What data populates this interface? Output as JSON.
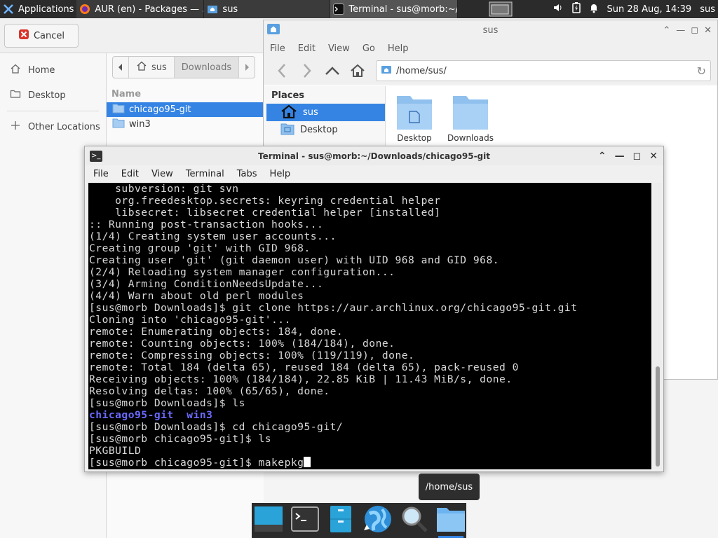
{
  "panel": {
    "applications_label": "Applications",
    "tasks": [
      {
        "label": "AUR (en) - Packages — ...",
        "icon": "firefox-icon"
      },
      {
        "label": "sus",
        "icon": "folder-home-icon"
      },
      {
        "label": "Terminal - sus@morb:~/...",
        "icon": "terminal-icon"
      }
    ],
    "clock": "Sun 28 Aug, 14:39",
    "user": "sus"
  },
  "chooser": {
    "cancel_label": "Cancel",
    "sidebar": [
      "Home",
      "Desktop",
      "Other Locations"
    ],
    "path": [
      "sus",
      "Downloads"
    ],
    "column_name": "Name",
    "files": [
      {
        "name": "chicago95-git",
        "selected": true
      },
      {
        "name": "win3",
        "selected": false
      }
    ]
  },
  "thunar": {
    "title": "sus",
    "menu": [
      "File",
      "Edit",
      "View",
      "Go",
      "Help"
    ],
    "location": "/home/sus/",
    "places_header": "Places",
    "places": [
      {
        "label": "sus",
        "selected": true
      },
      {
        "label": "Desktop",
        "selected": false
      }
    ],
    "items": [
      "Desktop",
      "Downloads"
    ]
  },
  "terminal": {
    "title": "Terminal - sus@morb:~/Downloads/chicago95-git",
    "menu": [
      "File",
      "Edit",
      "View",
      "Terminal",
      "Tabs",
      "Help"
    ],
    "lines": [
      "    subversion: git svn",
      "    org.freedesktop.secrets: keyring credential helper",
      "    libsecret: libsecret credential helper [installed]",
      ":: Running post-transaction hooks...",
      "(1/4) Creating system user accounts...",
      "Creating group 'git' with GID 968.",
      "Creating user 'git' (git daemon user) with UID 968 and GID 968.",
      "(2/4) Reloading system manager configuration...",
      "(3/4) Arming ConditionNeedsUpdate...",
      "(4/4) Warn about old perl modules",
      "[sus@morb Downloads]$ git clone https://aur.archlinux.org/chicago95-git.git",
      "Cloning into 'chicago95-git'...",
      "remote: Enumerating objects: 184, done.",
      "remote: Counting objects: 100% (184/184), done.",
      "remote: Compressing objects: 100% (119/119), done.",
      "remote: Total 184 (delta 65), reused 184 (delta 65), pack-reused 0",
      "Receiving objects: 100% (184/184), 22.85 KiB | 11.43 MiB/s, done.",
      "Resolving deltas: 100% (65/65), done.",
      "[sus@morb Downloads]$ ls",
      "chicago95-git  win3",
      "[sus@morb Downloads]$ cd chicago95-git/",
      "[sus@morb chicago95-git]$ ls",
      "PKGBUILD",
      "[sus@morb chicago95-git]$ makepkg"
    ],
    "highlight_lines": [
      19
    ]
  },
  "tooltip": "/home/sus",
  "dock": [
    "show-desktop-icon",
    "terminal-icon",
    "file-manager-icon",
    "web-browser-icon",
    "app-finder-icon",
    "home-folder-icon"
  ],
  "colors": {
    "selection": "#3584e4",
    "panel": "#2b2b2b",
    "ls_dir": "#6a6aff"
  }
}
